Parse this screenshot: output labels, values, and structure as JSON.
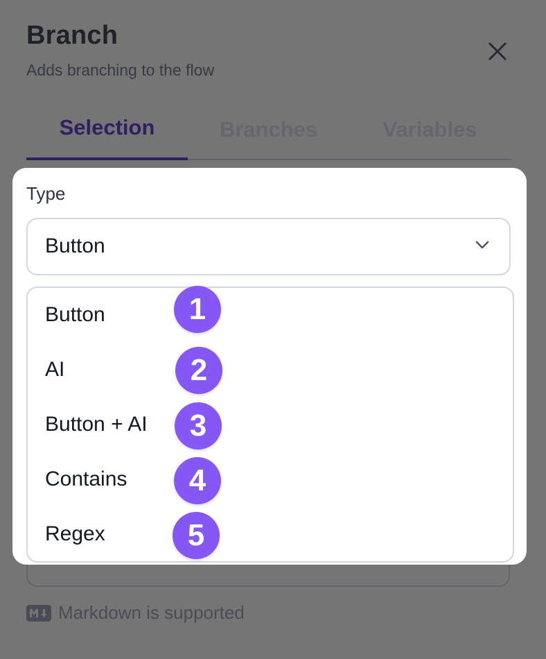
{
  "panel": {
    "title": "Branch",
    "subtitle": "Adds branching to the flow",
    "close_icon": "close-x-icon"
  },
  "tabs": [
    {
      "label": "Selection",
      "active": true
    },
    {
      "label": "Branches",
      "active": false
    },
    {
      "label": "Variables",
      "active": false
    }
  ],
  "type_field": {
    "label": "Type",
    "selected_value": "Button",
    "chevron_icon": "chevron-down-icon"
  },
  "dropdown": {
    "options": [
      {
        "label": "Button",
        "badge": "1"
      },
      {
        "label": "AI",
        "badge": "2"
      },
      {
        "label": "Button + AI",
        "badge": "3"
      },
      {
        "label": "Contains",
        "badge": "4"
      },
      {
        "label": "Regex",
        "badge": "5"
      }
    ]
  },
  "footer": {
    "markdown_icon": "markdown-icon",
    "markdown_note": "Markdown is supported"
  },
  "colors": {
    "accent": "#302062",
    "badge": "#8558f5",
    "overlay": "#757575"
  }
}
